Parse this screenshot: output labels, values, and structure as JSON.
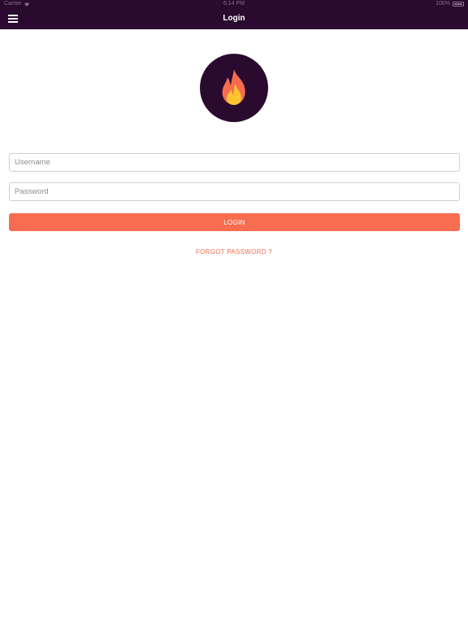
{
  "status_bar": {
    "carrier": "Carrier",
    "time": "6:14 PM",
    "battery": "100%",
    "battery_level": 1.0
  },
  "header": {
    "title": "Login",
    "menu_icon": "hamburger-menu-icon",
    "background": "#2a0a2e"
  },
  "logo": {
    "icon": "flame-icon",
    "background": "#2a0a2e",
    "flame_outer": "#f86c4f",
    "flame_inner": "#fbc531"
  },
  "form": {
    "username_placeholder": "Username",
    "username_value": "",
    "password_placeholder": "Password",
    "password_value": "",
    "login_label": "LOGIN",
    "forgot_label": "FORGOT PASSWORD ?"
  },
  "colors": {
    "accent": "#f86c4f",
    "header": "#2a0a2e"
  }
}
